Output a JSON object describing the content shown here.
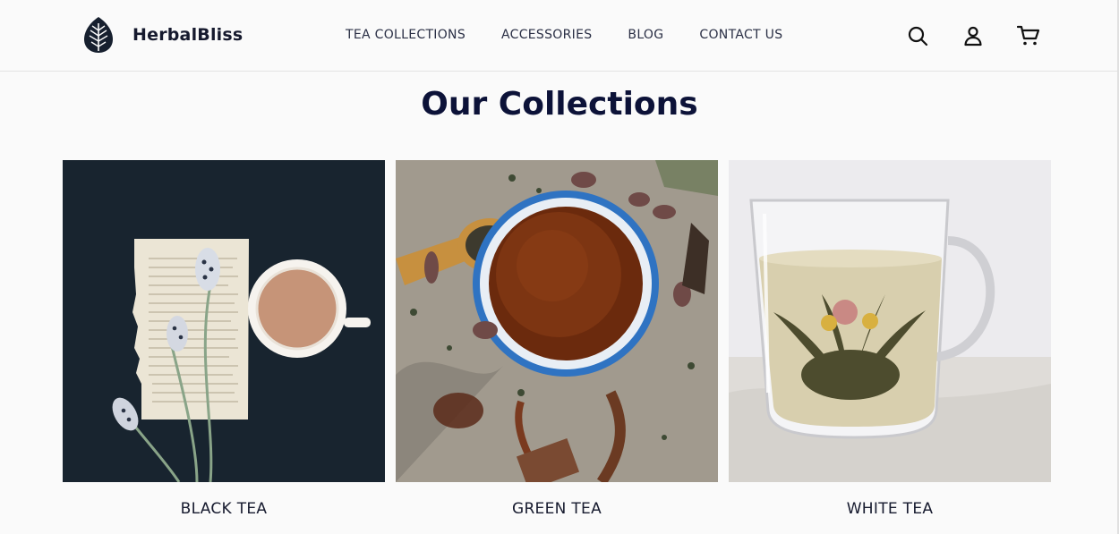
{
  "brand": {
    "name": "HerbalBliss",
    "logo_icon": "leaf-icon"
  },
  "nav": {
    "items": [
      {
        "label": "TEA COLLECTIONS"
      },
      {
        "label": "ACCESSORIES"
      },
      {
        "label": "BLOG"
      },
      {
        "label": "CONTACT US"
      }
    ]
  },
  "header_icons": [
    "search-icon",
    "user-icon",
    "cart-icon"
  ],
  "section": {
    "title": "Our Collections"
  },
  "collections": [
    {
      "label": "BLACK TEA",
      "image": "black-tea-flatlay"
    },
    {
      "label": "GREEN TEA",
      "image": "green-tea-bowl"
    },
    {
      "label": "WHITE TEA",
      "image": "white-tea-glass-cup"
    }
  ],
  "colors": {
    "brand_navy": "#0c1238",
    "background": "#fafafa",
    "logo": "#17202f"
  }
}
